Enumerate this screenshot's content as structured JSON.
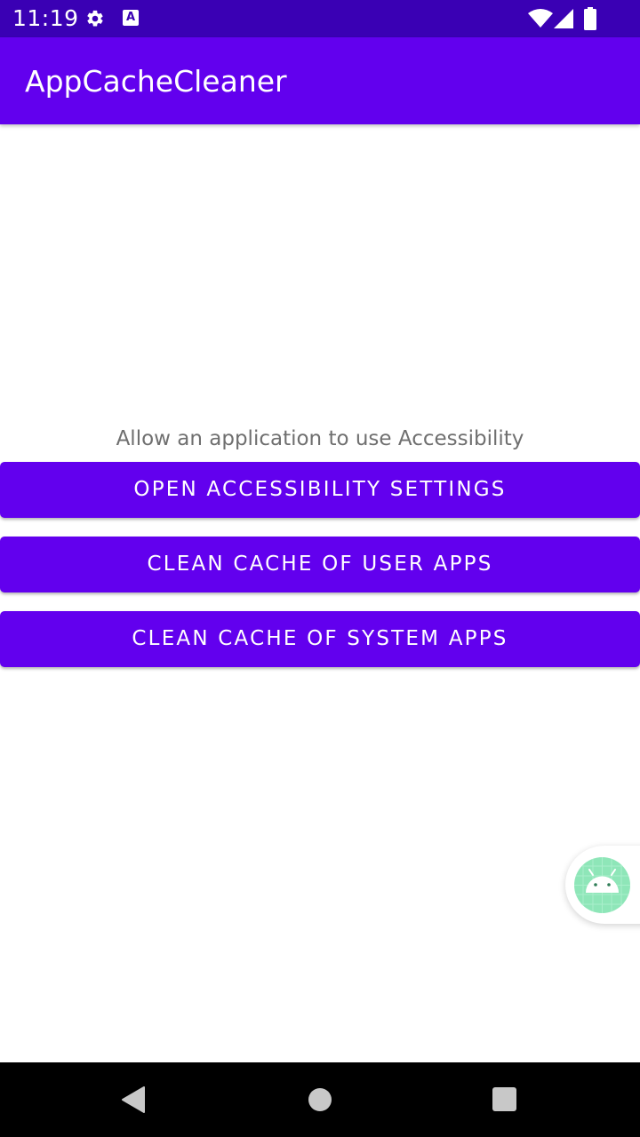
{
  "status_bar": {
    "time": "11:19",
    "icons": [
      "gear-icon",
      "accessibility-a-icon",
      "wifi-icon",
      "signal-icon",
      "battery-icon"
    ],
    "a_glyph": "A"
  },
  "app_bar": {
    "title": "AppCacheCleaner"
  },
  "main": {
    "hint": "Allow an application to use Accessibility",
    "buttons": [
      {
        "label": "OPEN ACCESSIBILITY SETTINGS"
      },
      {
        "label": "CLEAN CACHE OF USER APPS"
      },
      {
        "label": "CLEAN CACHE OF SYSTEM APPS"
      }
    ]
  },
  "floating": {
    "icon": "android-icon"
  },
  "nav_bar": {
    "icons": [
      "back-icon",
      "home-icon",
      "recents-icon"
    ]
  },
  "colors": {
    "status_bar": "#3a00b4",
    "primary": "#6200ee",
    "hint_text": "#6f6f6f",
    "android_badge": "#8ee6b8"
  }
}
